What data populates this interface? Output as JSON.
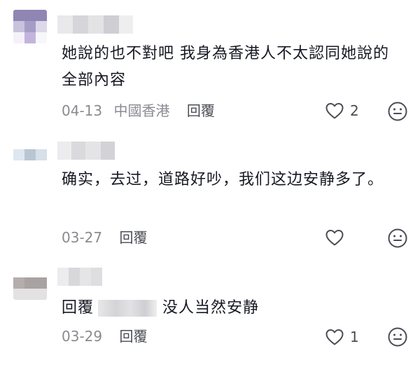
{
  "comments": [
    {
      "text": "她說的也不對吧 我身為香港人不太認同她說的全部內容",
      "date": "04-13",
      "region": "中國香港",
      "reply_label": "回覆",
      "like_count": "2"
    },
    {
      "text": "确实，去过，道路好吵，我们这边安静多了。",
      "date": "03-27",
      "reply_label": "回覆",
      "like_count": ""
    },
    {
      "reply_prefix": "回覆",
      "text": "没人当然安静",
      "date": "03-29",
      "reply_label": "回覆",
      "like_count": "1"
    }
  ],
  "icons": {
    "like": "heart-outline-icon",
    "reaction": "emoji-face-icon"
  },
  "colors": {
    "text": "#161823",
    "meta": "#8a8b91",
    "icon": "#4a4c55"
  }
}
